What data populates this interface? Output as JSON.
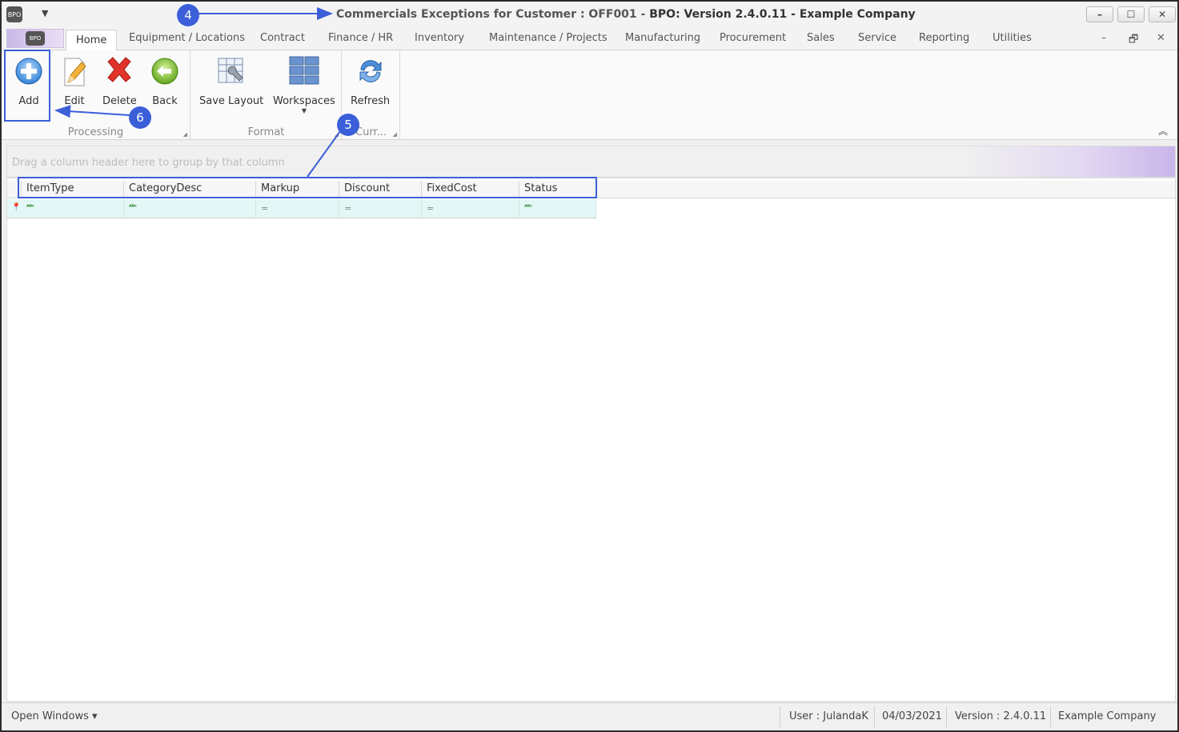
{
  "window": {
    "title_part1": "Commercials Exceptions for Customer : OFF001 - ",
    "title_part2": "BPO: Version 2.4.0.11 - Example Company",
    "controls": [
      "–",
      "☐",
      "✕"
    ]
  },
  "tabs": {
    "items": [
      "Home",
      "Equipment / Locations",
      "Contract",
      "Finance / HR",
      "Inventory",
      "Maintenance / Projects",
      "Manufacturing",
      "Procurement",
      "Sales",
      "Service",
      "Reporting",
      "Utilities"
    ],
    "mdi_controls": [
      "–",
      "🗗",
      "✕"
    ]
  },
  "ribbon": {
    "processing": {
      "label": "Processing",
      "add": "Add",
      "edit": "Edit",
      "delete": "Delete",
      "back": "Back"
    },
    "format": {
      "label": "Format",
      "save_layout": "Save Layout",
      "workspaces": "Workspaces"
    },
    "current": {
      "label": "Curr...",
      "refresh": "Refresh"
    }
  },
  "groupby": {
    "placeholder": "Drag a column header here to group by that column"
  },
  "grid": {
    "columns": [
      "ItemType",
      "CategoryDesc",
      "Markup",
      "Discount",
      "FixedCost",
      "Status"
    ]
  },
  "statusbar": {
    "open_windows": "Open Windows ▾",
    "user": "User : JulandaK",
    "date": "04/03/2021",
    "version": "Version : 2.4.0.11",
    "company": "Example Company"
  },
  "annotations": {
    "c4": "4",
    "c5": "5",
    "c6": "6"
  },
  "colors": {
    "annotation": "#3b5fd9",
    "filter_row": "#e3f8f6"
  }
}
